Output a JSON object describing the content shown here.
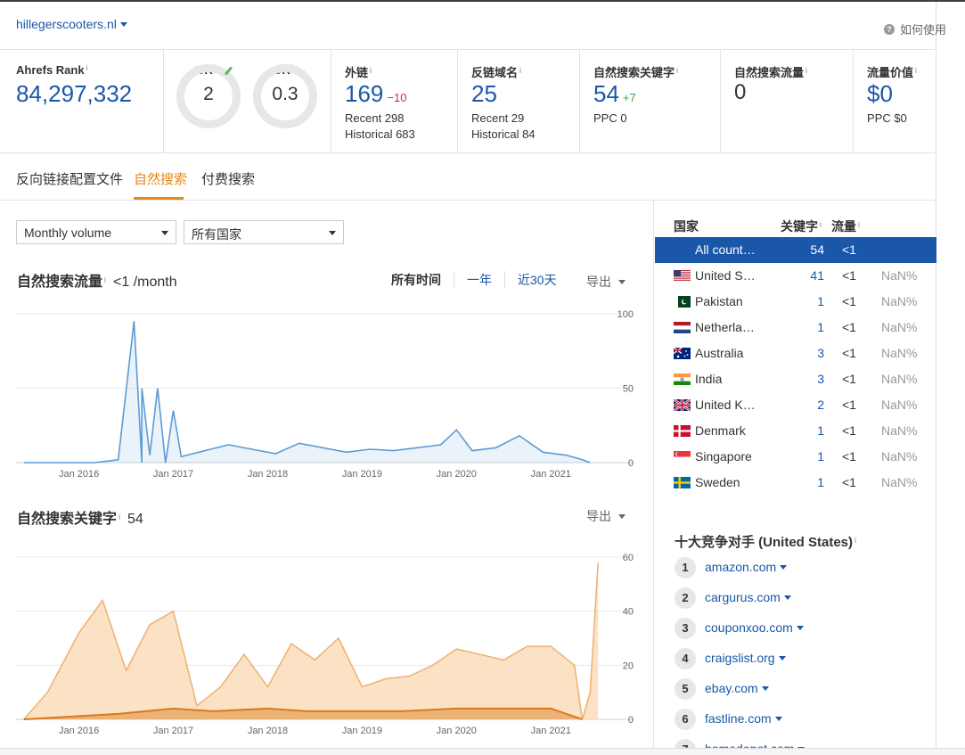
{
  "header": {
    "domain": "hillegerscooters.nl",
    "help": "如何使用"
  },
  "metrics": {
    "ahrefs_rank": {
      "label": "Ahrefs Rank",
      "value": "84,297,332"
    },
    "ur": {
      "label": "UR",
      "value": "2"
    },
    "dr": {
      "label": "DR",
      "value": "0.3"
    },
    "backlinks": {
      "label": "外链",
      "value": "169",
      "delta": "−10",
      "recent": "Recent 298",
      "historical": "Historical 683"
    },
    "ref_domains": {
      "label": "反链域名",
      "value": "25",
      "recent": "Recent 29",
      "historical": "Historical 84"
    },
    "organic_keywords": {
      "label": "自然搜索关键字",
      "value": "54",
      "delta": "+7",
      "ppc": "PPC 0"
    },
    "organic_traffic": {
      "label": "自然搜索流量",
      "value": "0"
    },
    "traffic_value": {
      "label": "流量价值",
      "value": "$0",
      "ppc": "PPC $0"
    }
  },
  "tabs": [
    "反向链接配置文件",
    "自然搜索",
    "付费搜索"
  ],
  "filters": {
    "volume": "Monthly volume",
    "country": "所有国家"
  },
  "traffic_chart": {
    "title": "自然搜索流量",
    "value": "<1 /month",
    "ranges": [
      "所有时间",
      "一年",
      "近30天"
    ],
    "export": "导出"
  },
  "keywords_chart": {
    "title": "自然搜索关键字",
    "value": "54",
    "export": "导出"
  },
  "country_table": {
    "headers": {
      "country": "国家",
      "keywords": "关键字",
      "traffic": "流量"
    },
    "rows": [
      {
        "name": "All count…",
        "kw": "54",
        "traffic": "<1",
        "pct": "",
        "flag": "none"
      },
      {
        "name": "United S…",
        "kw": "41",
        "traffic": "<1",
        "pct": "NaN%",
        "flag": "us"
      },
      {
        "name": "Pakistan",
        "kw": "1",
        "traffic": "<1",
        "pct": "NaN%",
        "flag": "pk"
      },
      {
        "name": "Netherla…",
        "kw": "1",
        "traffic": "<1",
        "pct": "NaN%",
        "flag": "nl"
      },
      {
        "name": "Australia",
        "kw": "3",
        "traffic": "<1",
        "pct": "NaN%",
        "flag": "au"
      },
      {
        "name": "India",
        "kw": "3",
        "traffic": "<1",
        "pct": "NaN%",
        "flag": "in"
      },
      {
        "name": "United K…",
        "kw": "2",
        "traffic": "<1",
        "pct": "NaN%",
        "flag": "uk"
      },
      {
        "name": "Denmark",
        "kw": "1",
        "traffic": "<1",
        "pct": "NaN%",
        "flag": "dk"
      },
      {
        "name": "Singapore",
        "kw": "1",
        "traffic": "<1",
        "pct": "NaN%",
        "flag": "sg"
      },
      {
        "name": "Sweden",
        "kw": "1",
        "traffic": "<1",
        "pct": "NaN%",
        "flag": "se"
      }
    ]
  },
  "competitors": {
    "title": "十大竞争对手 (United States)",
    "items": [
      "amazon.com",
      "cargurus.com",
      "couponxoo.com",
      "craigslist.org",
      "ebay.com",
      "fastline.com",
      "homedepot.com"
    ]
  },
  "colors": {
    "link": "#1a57a8",
    "accent": "#e8871a",
    "traffic_line": "#5b9bd5",
    "keyword_area": "#fbd8b0",
    "keyword_line": "#f0b070",
    "keyword_dark": "#d97a1a"
  },
  "chart_data": [
    {
      "type": "line",
      "title": "自然搜索流量",
      "x_ticks": [
        "Jan 2016",
        "Jan 2017",
        "Jan 2018",
        "Jan 2019",
        "Jan 2020",
        "Jan 2021"
      ],
      "y_ticks": [
        0,
        50,
        100
      ],
      "ylim": [
        0,
        100
      ],
      "series": [
        {
          "points": [
            [
              "2015-06",
              0
            ],
            [
              "2016-03",
              0
            ],
            [
              "2016-06",
              2
            ],
            [
              "2016-08",
              95
            ],
            [
              "2016-09",
              0
            ],
            [
              "2016-09",
              50
            ],
            [
              "2016-10",
              5
            ],
            [
              "2016-11",
              50
            ],
            [
              "2016-12",
              0
            ],
            [
              "2017-01",
              35
            ],
            [
              "2017-02",
              4
            ],
            [
              "2017-05",
              8
            ],
            [
              "2017-08",
              12
            ],
            [
              "2017-11",
              9
            ],
            [
              "2018-02",
              6
            ],
            [
              "2018-05",
              13
            ],
            [
              "2018-08",
              10
            ],
            [
              "2018-11",
              7
            ],
            [
              "2019-02",
              9
            ],
            [
              "2019-05",
              8
            ],
            [
              "2019-08",
              10
            ],
            [
              "2019-11",
              12
            ],
            [
              "2020-01",
              22
            ],
            [
              "2020-03",
              8
            ],
            [
              "2020-06",
              10
            ],
            [
              "2020-09",
              18
            ],
            [
              "2020-12",
              7
            ],
            [
              "2021-03",
              5
            ],
            [
              "2021-05",
              2
            ],
            [
              "2021-06",
              0
            ]
          ]
        }
      ]
    },
    {
      "type": "area",
      "title": "自然搜索关键字",
      "x_ticks": [
        "Jan 2016",
        "Jan 2017",
        "Jan 2018",
        "Jan 2019",
        "Jan 2020",
        "Jan 2021"
      ],
      "y_ticks": [
        0,
        20,
        40,
        60
      ],
      "ylim": [
        0,
        60
      ],
      "series": [
        {
          "points": [
            [
              "2015-06",
              0
            ],
            [
              "2015-09",
              10
            ],
            [
              "2016-01",
              32
            ],
            [
              "2016-04",
              44
            ],
            [
              "2016-07",
              18
            ],
            [
              "2016-10",
              35
            ],
            [
              "2017-01",
              40
            ],
            [
              "2017-04",
              5
            ],
            [
              "2017-07",
              12
            ],
            [
              "2017-10",
              24
            ],
            [
              "2018-01",
              12
            ],
            [
              "2018-04",
              28
            ],
            [
              "2018-07",
              22
            ],
            [
              "2018-10",
              30
            ],
            [
              "2019-01",
              12
            ],
            [
              "2019-04",
              15
            ],
            [
              "2019-07",
              16
            ],
            [
              "2019-10",
              20
            ],
            [
              "2020-01",
              26
            ],
            [
              "2020-04",
              24
            ],
            [
              "2020-07",
              22
            ],
            [
              "2020-10",
              27
            ],
            [
              "2021-01",
              27
            ],
            [
              "2021-04",
              20
            ],
            [
              "2021-05",
              0
            ],
            [
              "2021-06",
              10
            ],
            [
              "2021-07",
              58
            ]
          ]
        },
        {
          "points": [
            [
              "2015-06",
              0
            ],
            [
              "2016-06",
              2
            ],
            [
              "2017-01",
              4
            ],
            [
              "2017-06",
              3
            ],
            [
              "2018-01",
              4
            ],
            [
              "2018-06",
              3
            ],
            [
              "2019-01",
              3
            ],
            [
              "2019-06",
              3
            ],
            [
              "2020-01",
              4
            ],
            [
              "2020-06",
              4
            ],
            [
              "2021-01",
              4
            ],
            [
              "2021-05",
              0
            ]
          ]
        }
      ]
    }
  ]
}
